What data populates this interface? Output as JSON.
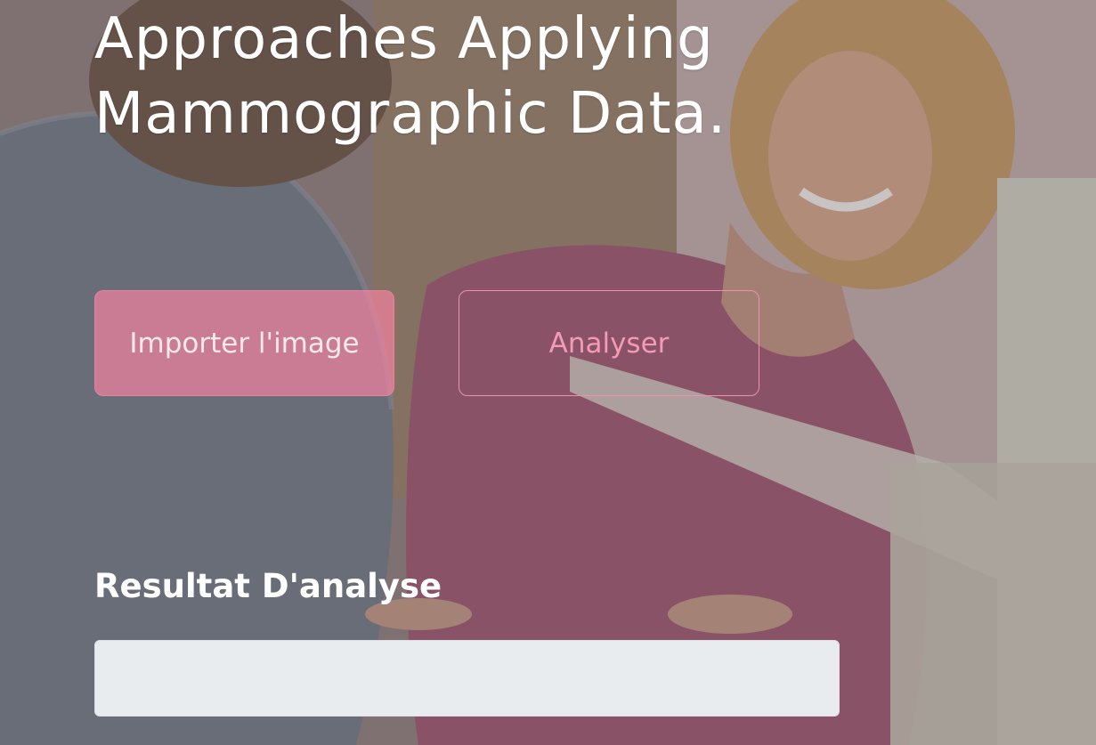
{
  "hero": {
    "title_line1": "Approaches Applying",
    "title_line2": "Mammographic Data."
  },
  "actions": {
    "import_label": "Importer l'image",
    "analyse_label": "Analyser"
  },
  "result": {
    "label": "Resultat D'analyse",
    "value": ""
  },
  "background": {
    "subject": "photo-mammography-nurse-patient"
  },
  "colors": {
    "accent_pink": "#f08fae",
    "button_fill": "#f082a0",
    "result_bg": "#e9ecef",
    "title_text": "#ffffff"
  }
}
